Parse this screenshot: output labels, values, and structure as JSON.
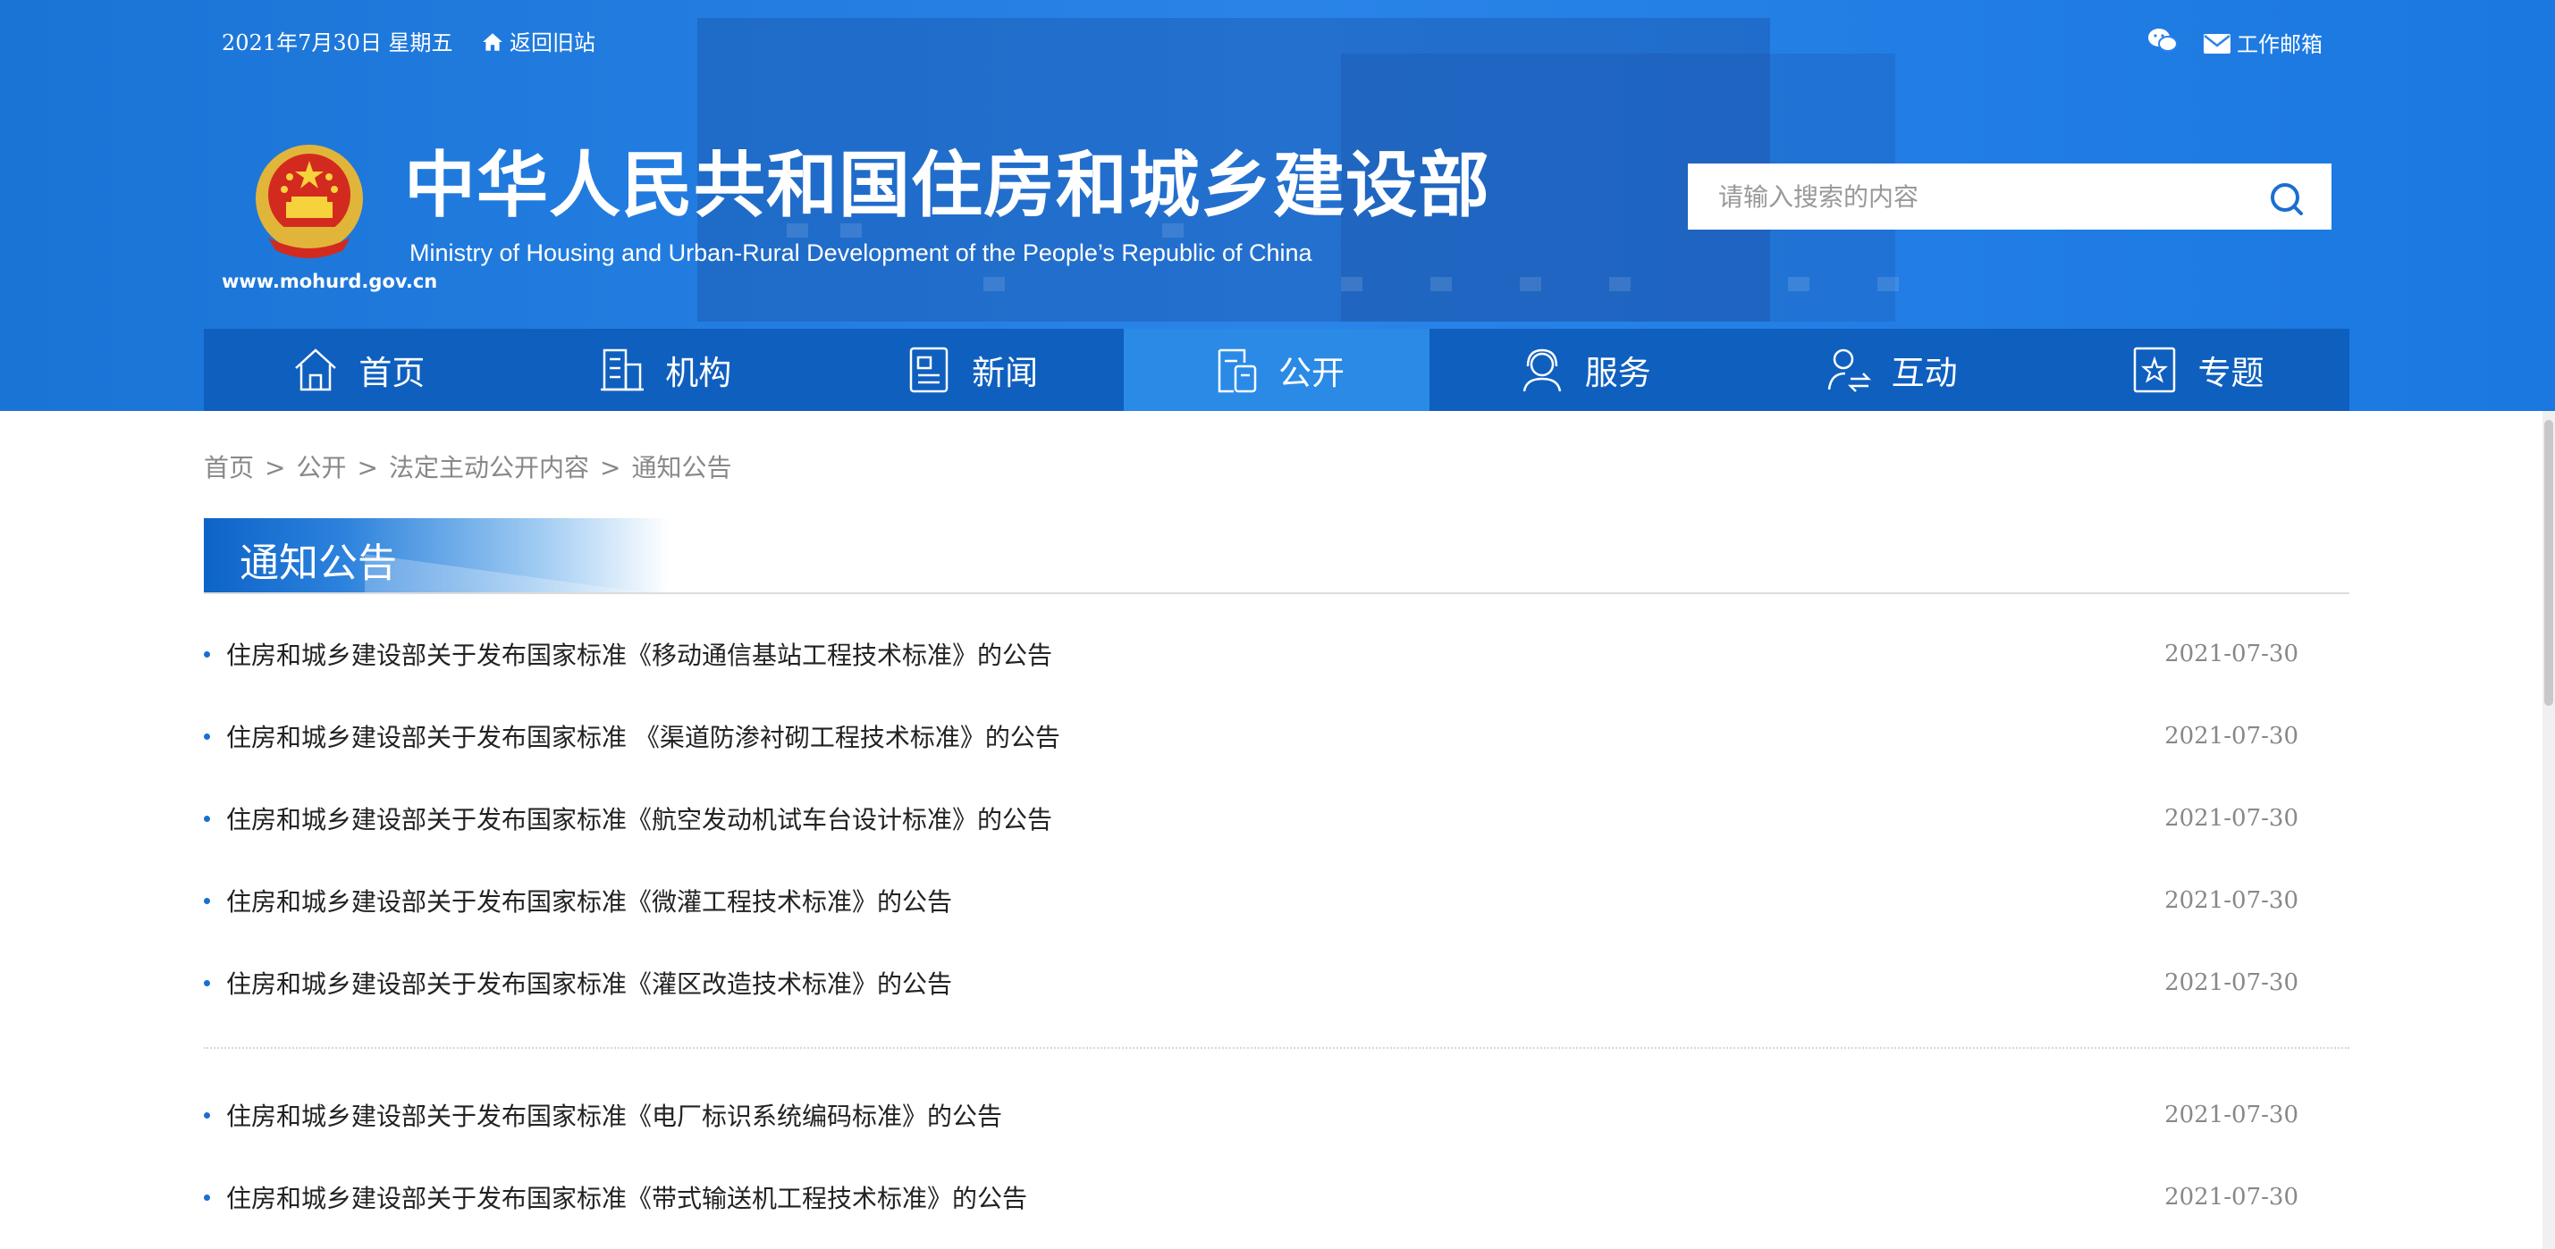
{
  "topbar": {
    "date": "2021年7月30日 星期五",
    "old_site": "返回旧站",
    "mail": "工作邮箱"
  },
  "header": {
    "title": "中华人民共和国住房和城乡建设部",
    "subtitle": "Ministry of Housing and Urban-Rural Development of the People’s Republic of China",
    "domain": "www.mohurd.gov.cn",
    "search_placeholder": "请输入搜索的内容"
  },
  "nav": [
    {
      "label": "首页",
      "icon": "home-icon"
    },
    {
      "label": "机构",
      "icon": "building-icon"
    },
    {
      "label": "新闻",
      "icon": "newspaper-icon"
    },
    {
      "label": "公开",
      "icon": "document-icon",
      "active": true
    },
    {
      "label": "服务",
      "icon": "headset-icon"
    },
    {
      "label": "互动",
      "icon": "exchange-icon"
    },
    {
      "label": "专题",
      "icon": "star-icon"
    }
  ],
  "breadcrumb": [
    "首页",
    "公开",
    "法定主动公开内容",
    "通知公告"
  ],
  "section_title": "通知公告",
  "notices": [
    {
      "title": "住房和城乡建设部关于发布国家标准《移动通信基站工程技术标准》的公告",
      "date": "2021-07-30"
    },
    {
      "title": "住房和城乡建设部关于发布国家标准 《渠道防渗衬砌工程技术标准》的公告",
      "date": "2021-07-30"
    },
    {
      "title": "住房和城乡建设部关于发布国家标准《航空发动机试车台设计标准》的公告",
      "date": "2021-07-30"
    },
    {
      "title": "住房和城乡建设部关于发布国家标准《微灌工程技术标准》的公告",
      "date": "2021-07-30"
    },
    {
      "title": "住房和城乡建设部关于发布国家标准《灌区改造技术标准》的公告",
      "date": "2021-07-30"
    },
    {
      "title": "住房和城乡建设部关于发布国家标准《电厂标识系统编码标准》的公告",
      "date": "2021-07-30"
    },
    {
      "title": "住房和城乡建设部关于发布国家标准《带式输送机工程技术标准》的公告",
      "date": "2021-07-30"
    }
  ],
  "colors": {
    "header_blue": "#2a84e8",
    "nav_blue": "#0f5fbe",
    "nav_active": "#2a8ae6"
  }
}
